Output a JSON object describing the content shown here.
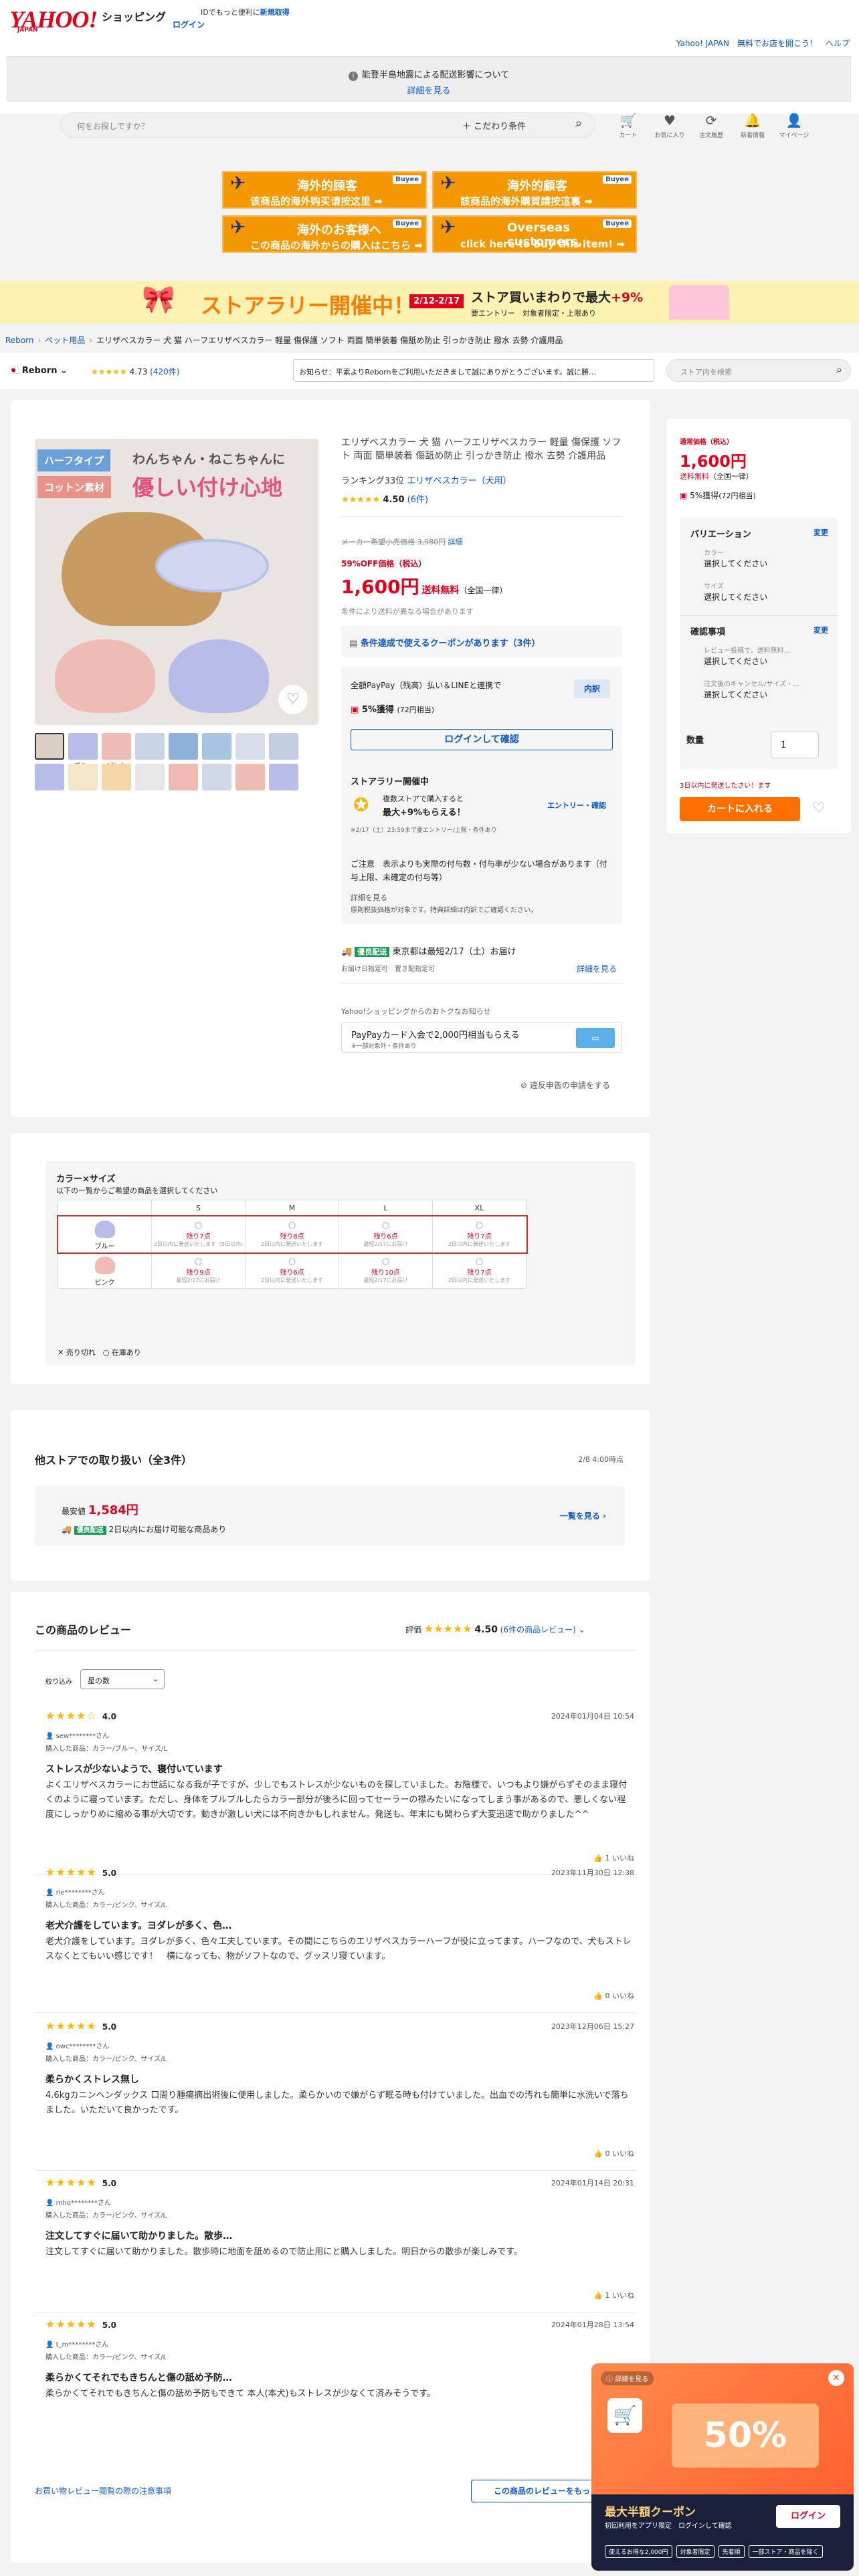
{
  "header": {
    "brand": "YAHOO!",
    "brand_sub": "JAPAN",
    "shopping": "ショッピング",
    "top_note": "IDでもっと便利に",
    "top_note_link": "新規取得",
    "login": "ログイン",
    "links": "Yahoo! JAPAN　無料でお店を開こう！　ヘルプ"
  },
  "notice": {
    "text": "能登半島地震による配送影響について",
    "link": "詳細を見る"
  },
  "search": {
    "placeholder": "何をお探しですか？",
    "conditions": "＋ こだわり条件"
  },
  "header_icons": [
    {
      "label": "カート",
      "icon": "cart-icon",
      "g": "🛒"
    },
    {
      "label": "お気に入り",
      "icon": "heart-icon",
      "g": "♥"
    },
    {
      "label": "注文履歴",
      "icon": "history-icon",
      "g": "⟳"
    },
    {
      "label": "新着情報",
      "icon": "bell-icon",
      "g": "🔔"
    },
    {
      "label": "マイページ",
      "icon": "user-icon",
      "g": "👤"
    }
  ],
  "banners": [
    {
      "t1": "海外的顾客",
      "t2": "该商品的海外购买请按这里 ➡",
      "badge": "Buyee"
    },
    {
      "t1": "海外的顧客",
      "t2": "該商品的海外購買請按這裏 ➡",
      "badge": "Buyee"
    },
    {
      "t1": "海外のお客様へ",
      "t2": "この商品の海外からの購入はこちら ➡",
      "badge": "Buyee"
    },
    {
      "t1": "Overseas customers,",
      "t2": "click here to buy this item! ➡",
      "badge": "Buyee"
    }
  ],
  "promo": {
    "headline": "ストアラリー開催中！",
    "dates": "2/12-2/17",
    "right1_pre": "ストア買いまわりで最大",
    "right1_em": "+9%",
    "right2": "要エントリー　対象者限定・上限あり"
  },
  "breadcrumb": {
    "items": [
      "Reborn",
      "ペット用品"
    ],
    "current": "エリザベスカラー 犬 猫 ハーフエリザベスカラー 軽量 傷保護 ソフト 両面 簡単装着 傷舐め防止 引っかき防止 撥水 去勢 介護用品"
  },
  "store": {
    "name": "Reborn",
    "rating": "4.73",
    "count": "(420件)",
    "notice": "お知らせ：平素よりRebornをご利用いただきまして誠にありがとうございます。誠に勝…",
    "search_placeholder": "ストア内を検索"
  },
  "gallery": {
    "label1": "ハーフタイプ",
    "label2": "コットン素材",
    "copy1": "わんちゃん・ねこちゃんに",
    "copy2": "優しい付け心地",
    "thumbs_row2_labels": [
      "",
      "ブルー",
      "ピンク",
      "",
      "",
      "",
      "",
      ""
    ]
  },
  "product": {
    "title": "エリザベスカラー 犬 猫 ハーフエリザベスカラー 軽量 傷保護 ソフト 両面 簡単装着 傷舐め防止 引っかき防止 撥水 去勢 介護用品",
    "ranking": "ランキング33位",
    "ranking_link": "エリザベスカラー（犬用）",
    "rating": "4.50",
    "reviews": "(6件)",
    "orig_price": "メーカー希望小売価格 3,980円",
    "orig_link": "詳細",
    "discount": "59%OFF価格（税込）",
    "price": "1,600円",
    "shipping": "送料無料",
    "shipping_note": "（全国一律）",
    "price_note": "条件により送料が異なる場合があります",
    "coupon": "条件達成で使えるクーポンがあります（3件）",
    "paypay_title": "全額PayPay（残高）払い＆LINEと連携で",
    "paypay_btn": "内訳",
    "paypay_points": "5%獲得",
    "paypay_sub": "(72円相当)",
    "login_btn": "ログインして確認",
    "rally_title": "ストアラリー開催中",
    "rally_text1": "複数ストアで購入すると",
    "rally_text2": "最大+9%もらえる！",
    "rally_btn": "エントリー・確認",
    "rally_note": "※2/17（土）23:59まで要エントリー/上限・条件あり",
    "caution": "ご注意　表示よりも実際の付与数・付与率が少ない場合があります（付与上限、未確定の付与等）",
    "caution_link": "詳細を見る",
    "caution_note": "原則税抜価格が対象です。特典詳細は内訳でご確認ください。",
    "delivery_badge": "優良配送",
    "delivery_text": "東京都は最短2/17（土）お届け",
    "delivery_sub": "お届け日指定可　置き配指定可",
    "delivery_link": "詳細を見る",
    "card_title": "Yahoo!ショッピングからのおトクなお知らせ",
    "card_text": "PayPayカード入会で2,000円相当もらえる",
    "card_sub": "※一部対象外・条件あり",
    "report": "違反申告の申請をする"
  },
  "buybox": {
    "label": "通常価格（税込）",
    "price": "1,600円",
    "ship": "送料無料",
    "ship_note": "（全国一律）",
    "points": "5%獲得",
    "points_sub": "(72円相当)",
    "variation": "バリエーション",
    "change": "変更",
    "color_label": "カラー",
    "color_val": "選択してください",
    "size_label": "サイズ",
    "size_val": "選択してください",
    "confirm": "確認事項",
    "change2": "変更",
    "confirm_label1": "レビュー投稿で、送料無料…",
    "confirm_val1": "選択してください",
    "confirm_label2": "注文後のキャンセル/サイズ・…",
    "confirm_val2": "選択してください",
    "qty_label": "数量",
    "qty": "1",
    "qty_note": "3日以内に発送したさい！ます",
    "cart_btn": "カートに入れる"
  },
  "variations": {
    "title": "カラー×サイズ",
    "subtitle": "以下の一覧からご希望の商品を選択してください",
    "sizes": [
      "S",
      "M",
      "L",
      "XL"
    ],
    "rows": [
      {
        "color": "ブルー",
        "cells": [
          [
            "残り7点",
            "2日以内に発送いたします（5日以内)"
          ],
          [
            "残り8点",
            "2日以内に発送いたします"
          ],
          [
            "残り6点",
            "最短2/17にお届け"
          ],
          [
            "残り7点",
            "2日以内に発送いたします"
          ]
        ]
      },
      {
        "color": "ピンク",
        "cells": [
          [
            "残り9点",
            "最短2/17にお届け"
          ],
          [
            "残り6点",
            "2日以内に発送いたします"
          ],
          [
            "残り10点",
            "最短2/17にお届け"
          ],
          [
            "残り7点",
            "2日以内に発送いたします"
          ]
        ]
      }
    ],
    "legend1": "売り切れ",
    "legend2": "在庫あり"
  },
  "other": {
    "title": "他ストアでの取り扱い（全3件）",
    "date": "2/8 4:00時点",
    "min_label": "最安値",
    "min_price": "1,584円",
    "badge": "優良配送",
    "note": "2日以内にお届け可能な商品あり",
    "link": "一覧を見る"
  },
  "reviews": {
    "title": "この商品のレビュー",
    "eval_label": "評価",
    "score": "4.50",
    "count_link": "(6件の商品レビュー)",
    "filter_label": "絞り込み",
    "filter_value": "星の数",
    "items": [
      {
        "stars": "★★★★☆",
        "score": "4.0",
        "date": "2024年01月04日 10:54",
        "name": "sew********さん",
        "product": "購入した商品：カラー/ブルー、サイズ/L",
        "head": "ストレスが少ないようで、寝付いています",
        "body": "よくエリザベスカラーにお世話になる我が子ですが、少しでもストレスが少ないものを探していました。お陰様で、いつもより嫌がらずそのまま寝付くのように寝っています。ただし、身体をブルブルしたらカラー部分が後ろに回ってセーラーの襟みたいになってしまう事があるので、悪しくない程度にしっかりめに縮める事が大切です。動きが激しい犬には不向きかもしれません。発送も、年末にも関わらず大変迅速で助かりました^^",
        "likes": "1 いいね"
      },
      {
        "stars": "★★★★★",
        "score": "5.0",
        "date": "2023年11月30日 12:38",
        "name": "rie********さん",
        "product": "購入した商品：カラー/ピンク、サイズ/L",
        "head": "老犬介護をしています。ヨダレが多く、色…",
        "body": "老犬介護をしています。ヨダレが多く、色々工夫しています。その間にこちらのエリザベスカラーハーフが役に立ってます。ハーフなので、犬もストレスなくとてもいい感じです！　横になっても、物がソフトなので、グッスリ寝ています。",
        "likes": "0 いいね"
      },
      {
        "stars": "★★★★★",
        "score": "5.0",
        "date": "2023年12月06日 15:27",
        "name": "owc********さん",
        "product": "購入した商品：カラー/ピンク、サイズ/L",
        "head": "柔らかくストレス無し",
        "body": "4.6kgカニンヘンダックス 口周り腫瘍摘出術後に使用しました。柔らかいので嫌がらず眠る時も付けていました。出血での汚れも簡単に水洗いで落ちました。いただいて良かったです。",
        "likes": "0 いいね"
      },
      {
        "stars": "★★★★★",
        "score": "5.0",
        "date": "2024年01月14日 20:31",
        "name": "mho********さん",
        "product": "購入した商品：カラー/ピンク、サイズ/L",
        "head": "注文してすぐに届いて助かりました。散歩…",
        "body": "注文してすぐに届いて助かりました。散歩時に地面を舐めるので防止用にと購入しました。明日からの散歩が楽しみです。",
        "likes": "1 いいね"
      },
      {
        "stars": "★★★★★",
        "score": "5.0",
        "date": "2024年01月28日 13:54",
        "name": "t_m********さん",
        "product": "購入した商品：カラー/ピンク、サイズ/L",
        "head": "柔らかくてそれでもきちんと傷の舐め予防…",
        "body": "柔らかくてそれでもきちんと傷の舐め予防もできて 本人(本犬)もストレスが少なくて済みそうです。",
        "likes": "0 いいね"
      }
    ],
    "guide_link": "お買い物レビュー閲覧の際の注意事項",
    "all_btn": "この商品のレビューをもっと見る"
  },
  "coupon_popup": {
    "badge": "詳細を見る",
    "big": "50%",
    "title": "最大半額クーポン",
    "sub": "初回利用をアプリ限定　ログインして確認",
    "btn": "ログイン",
    "tags": [
      "使えるお得な2,000円",
      "対象者限定",
      "先着順",
      "一部ストア・商品を除く"
    ]
  }
}
